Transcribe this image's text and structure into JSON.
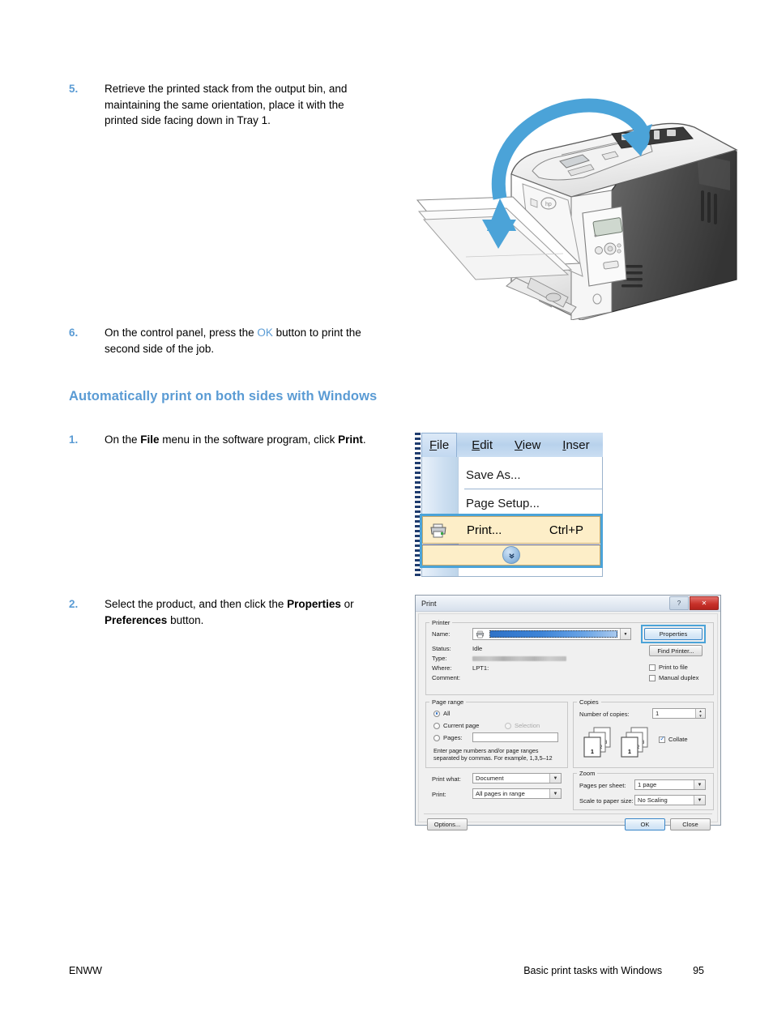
{
  "document": {
    "steps": [
      {
        "number": "5.",
        "text_parts": [
          {
            "t": "Retrieve the printed stack from the output bin, and maintaining the same orientation, place it with the printed side facing down in Tray 1.",
            "style": "normal"
          }
        ],
        "text": "Retrieve the printed stack from the output bin, and maintaining the same orientation, place it with the printed side facing down in Tray 1."
      },
      {
        "number": "6.",
        "text": "On the control panel, press the OK button to print the second side of the job.",
        "pre": "On the control panel, press the ",
        "accent": "OK",
        "post": " button to print the second side of the job."
      }
    ],
    "section_heading": "Automatically print on both sides with Windows",
    "windows_steps": [
      {
        "number": "1.",
        "pre": "On the ",
        "bold1": "File",
        "mid": " menu in the software program, click ",
        "bold2": "Print",
        "post": "."
      },
      {
        "number": "2.",
        "pre": "Select the product, and then click the ",
        "bold1": "Properties",
        "mid": " or ",
        "bold2": "Preferences",
        "post": " button."
      }
    ],
    "footer": {
      "left": "ENWW",
      "chapter": "Basic print tasks with Windows",
      "page": "95"
    }
  },
  "colors": {
    "accent_blue": "#5a9bd4",
    "callout_blue": "#4ba3d8",
    "menu_highlight": "#fdeec8",
    "close_red": "#c8322b"
  },
  "file_menu": {
    "menubar": [
      {
        "label": "File",
        "mnemonic": "F",
        "active": true
      },
      {
        "label": "Edit",
        "mnemonic": "E",
        "active": false
      },
      {
        "label": "View",
        "mnemonic": "V",
        "active": false
      },
      {
        "label": "Inser",
        "mnemonic": "I",
        "active": false
      }
    ],
    "items": [
      {
        "label": "Save As...",
        "mnemonic": "A"
      },
      {
        "label": "Page Setup...",
        "mnemonic": "u"
      }
    ],
    "print_item": {
      "label": "Print...",
      "accelerator": "Ctrl+P",
      "icon": "printer-icon",
      "highlighted": true
    },
    "expand_chevron": "»"
  },
  "print_dialog": {
    "title": "Print",
    "window_buttons": {
      "help": "?",
      "close": "✕"
    },
    "printer_group": {
      "legend": "Printer",
      "name_label": "Name:",
      "name_value": "",
      "status_label": "Status:",
      "status_value": "Idle",
      "type_label": "Type:",
      "type_value": "",
      "where_label": "Where:",
      "where_value": "LPT1:",
      "comment_label": "Comment:",
      "comment_value": "",
      "properties_button": "Properties",
      "find_printer_button": "Find Printer...",
      "print_to_file": {
        "label": "Print to file",
        "checked": false
      },
      "manual_duplex": {
        "label": "Manual duplex",
        "checked": false
      }
    },
    "page_range": {
      "legend": "Page range",
      "options": [
        {
          "label": "All",
          "selected": true,
          "disabled": false
        },
        {
          "label": "Current page",
          "selected": false,
          "disabled": false
        },
        {
          "label": "Selection",
          "selected": false,
          "disabled": true
        },
        {
          "label": "Pages:",
          "selected": false,
          "disabled": false
        }
      ],
      "pages_value": "",
      "hint_line1": "Enter page numbers and/or page ranges",
      "hint_line2": "separated by commas.  For example, 1,3,5–12"
    },
    "copies": {
      "legend": "Copies",
      "number_label": "Number of copies:",
      "number_value": "1",
      "collate": {
        "label": "Collate",
        "checked": true
      },
      "page_labels": [
        "1",
        "2",
        "3"
      ]
    },
    "print_what": {
      "label": "Print what:",
      "value": "Document"
    },
    "print_filter": {
      "label": "Print:",
      "value": "All pages in range"
    },
    "zoom_group": {
      "legend": "Zoom",
      "pages_per_sheet_label": "Pages per sheet:",
      "pages_per_sheet_value": "1 page",
      "scale_label": "Scale to paper size:",
      "scale_value": "No Scaling"
    },
    "buttons": {
      "options": "Options...",
      "ok": "OK",
      "close": "Close"
    }
  },
  "printer_illustration": {
    "alt": "Line drawing of a laser printer with Tray 1 open and a blue curved arrow showing paper being moved from the output bin into Tray 1",
    "arrow_color": "#4ba3d8"
  }
}
